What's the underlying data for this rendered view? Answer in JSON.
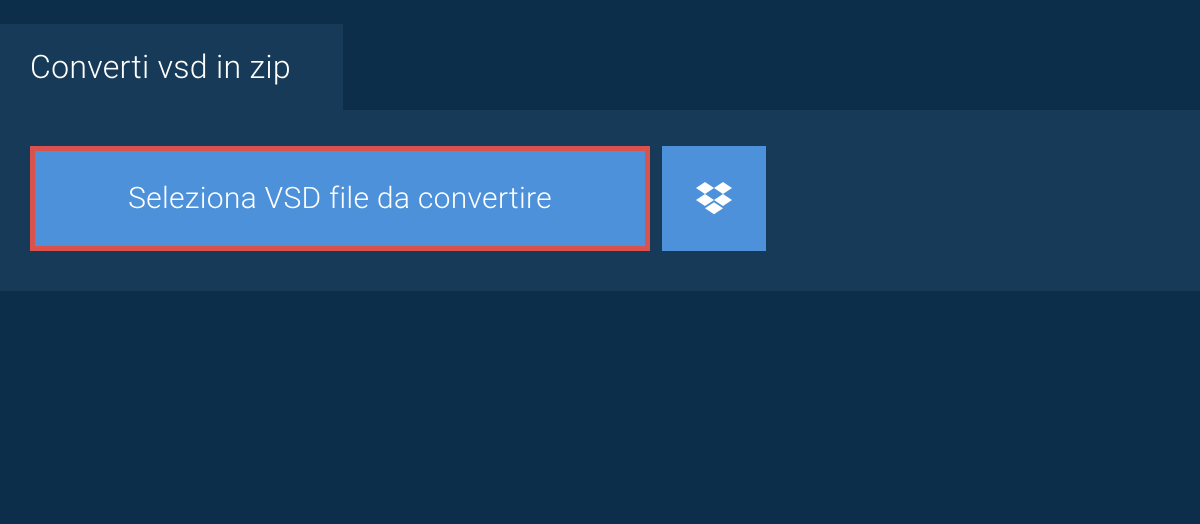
{
  "tab": {
    "label": "Converti vsd in zip"
  },
  "actions": {
    "select_file_label": "Seleziona VSD file da convertire",
    "dropbox_icon_name": "dropbox"
  },
  "colors": {
    "background": "#0d2e4b",
    "panel": "#163a57",
    "primary_button": "#4c91d9",
    "highlight_border": "#d9524e",
    "text": "#ffffff"
  }
}
